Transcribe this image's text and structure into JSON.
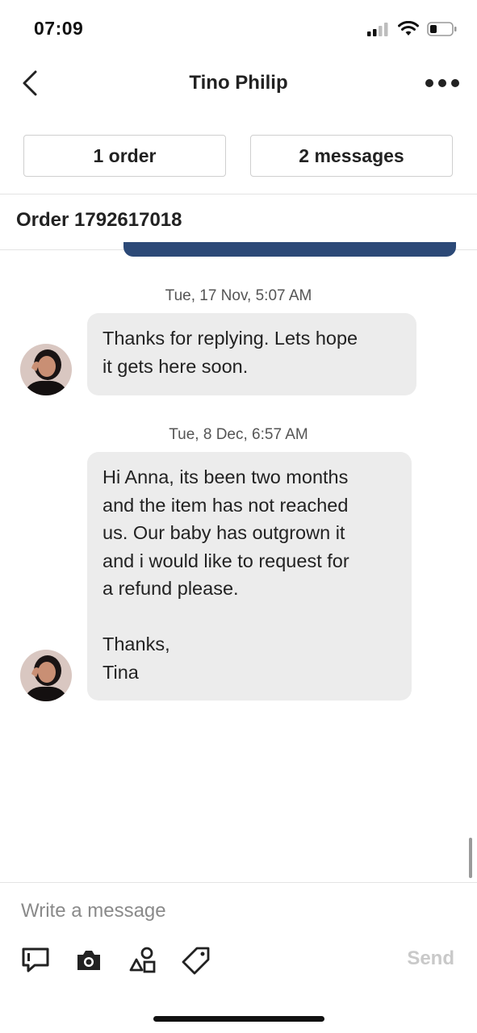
{
  "status_bar": {
    "time": "07:09"
  },
  "header": {
    "title": "Tino Philip"
  },
  "segments": {
    "orders_label": "1 order",
    "messages_label": "2 messages"
  },
  "order": {
    "title": "Order 1792617018"
  },
  "messages": [
    {
      "timestamp": "Tue, 17 Nov, 5:07 AM",
      "lines": [
        "Thanks for replying. Lets hope",
        "it gets here soon."
      ]
    },
    {
      "timestamp": "Tue, 8 Dec, 6:57 AM",
      "lines": [
        "Hi Anna, its been two months",
        "and the item has not reached",
        "us. Our baby has outgrown it",
        "and i would like to request for",
        "a refund please.",
        "",
        "Thanks,",
        "Tina"
      ]
    }
  ],
  "composer": {
    "placeholder": "Write a message",
    "send_label": "Send"
  },
  "colors": {
    "order_card": "#2c4977",
    "bubble": "#ececec",
    "send_disabled": "#c9c9c9"
  }
}
